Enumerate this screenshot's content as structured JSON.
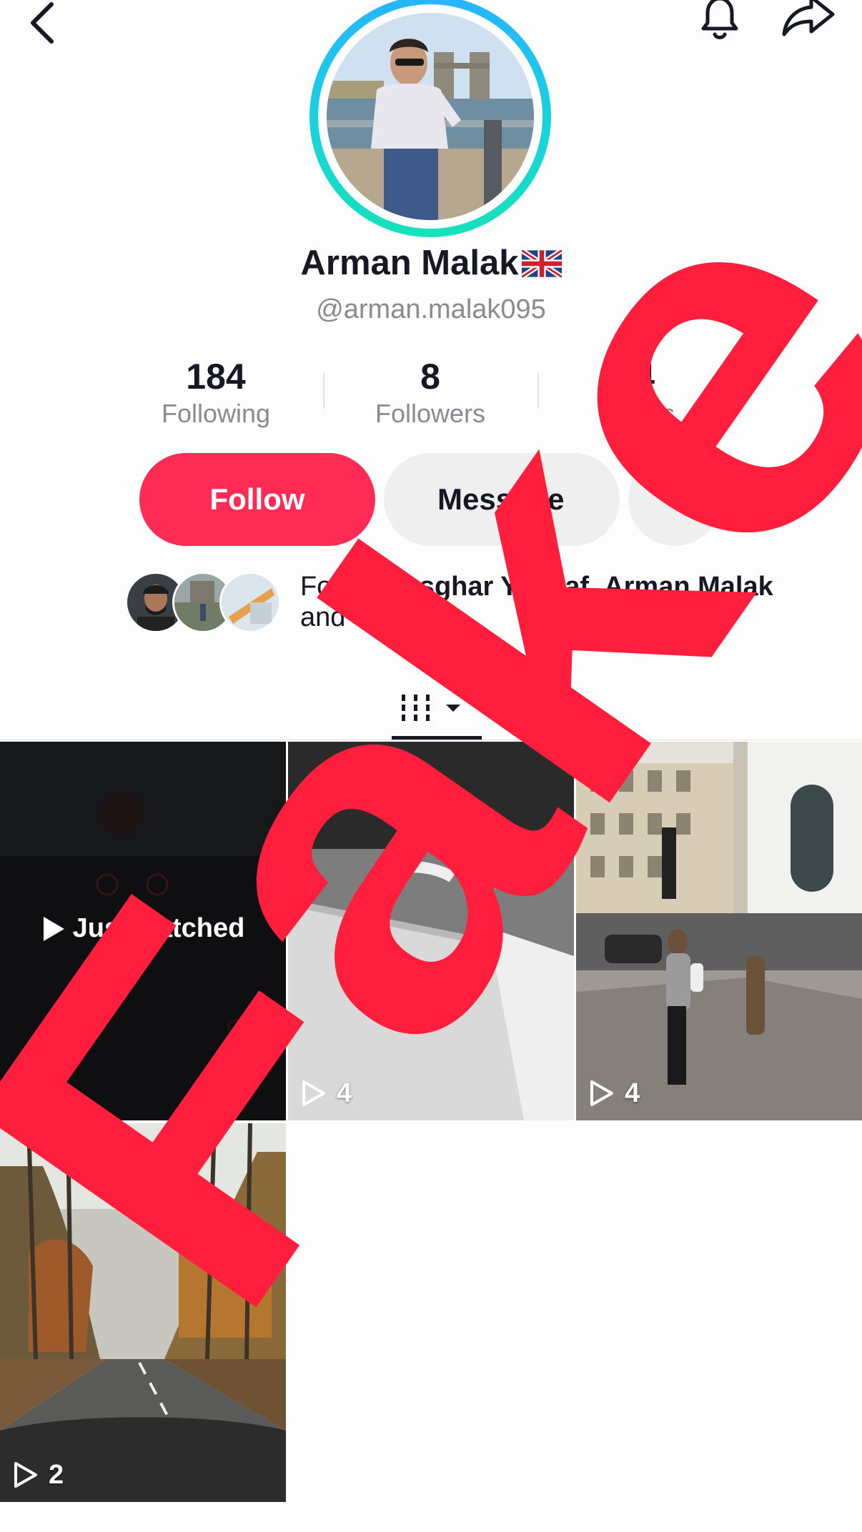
{
  "profile": {
    "display_name": "Arman Malak",
    "flag_icon": "uk-flag-icon",
    "handle": "@arman.malak095"
  },
  "stats": {
    "following": {
      "value": "184",
      "label": "Following"
    },
    "followers": {
      "value": "8",
      "label": "Followers"
    },
    "likes": {
      "value": "4",
      "label": "Likes"
    }
  },
  "actions": {
    "follow_label": "Follow",
    "message_label": "Message",
    "more_icon": "chevron-down-icon"
  },
  "mutual": {
    "prefix": "Follows ",
    "name1": "Asghar Yousaf",
    "sep": ", ",
    "name2": "Arman Malak",
    "suffix": " and 8 others"
  },
  "topbar": {
    "back_icon": "chevron-left-icon",
    "notify_icon": "bell-icon",
    "share_icon": "share-arrow-icon"
  },
  "tabs": {
    "videos_icon": "grid-videos-icon"
  },
  "videos": [
    {
      "views": "6",
      "overlay": "Just watched"
    },
    {
      "views": "4"
    },
    {
      "views": "4"
    },
    {
      "views": "2"
    }
  ],
  "watermark": {
    "text": "Fake",
    "color": "#ff1f3d"
  },
  "colors": {
    "accent": "#fe2c55",
    "ring_top": "#26b4ff",
    "ring_bottom": "#16e2b8"
  }
}
